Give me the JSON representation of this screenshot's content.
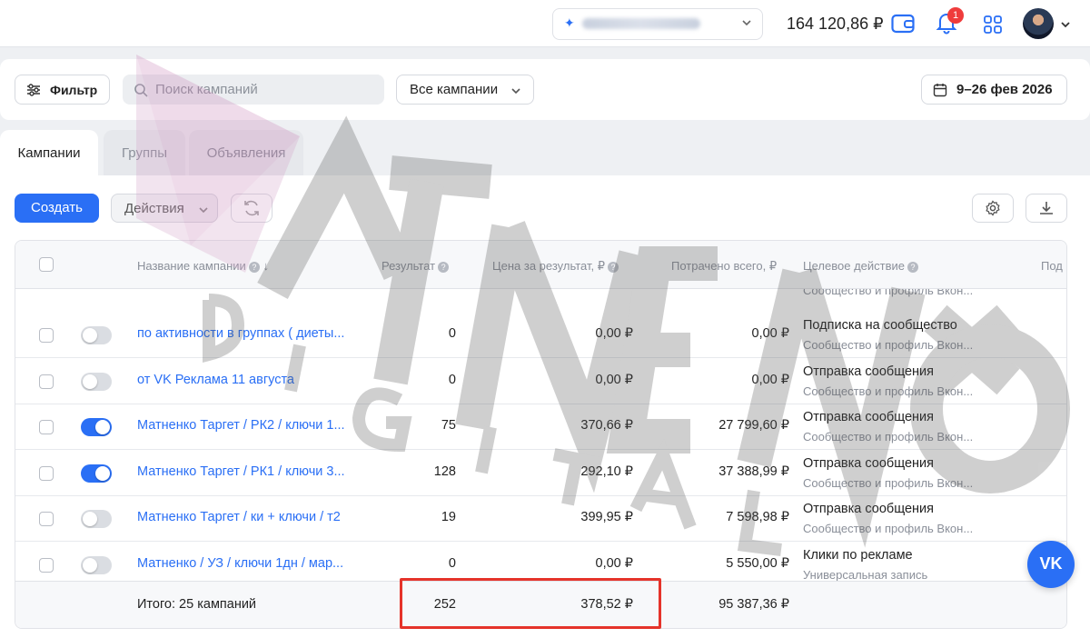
{
  "header": {
    "balance": "164 120,86 ₽",
    "notifications_count": "1"
  },
  "filterbar": {
    "filter_label": "Фильтр",
    "search_placeholder": "Поиск кампаний",
    "campaigns_select": "Все кампании",
    "date_range": "9–26 фев 2026"
  },
  "tabs": [
    {
      "label": "Кампании",
      "active": true
    },
    {
      "label": "Группы",
      "active": false
    },
    {
      "label": "Объявления",
      "active": false
    }
  ],
  "toolbar": {
    "create_label": "Создать",
    "actions_label": "Действия"
  },
  "table": {
    "columns": {
      "name": "Название кампании",
      "result": "Результат",
      "price": "Цена за результат, ₽",
      "spent": "Потрачено всего, ₽",
      "target": "Целевое действие",
      "extra": "Под"
    },
    "partial_top_sub": "Сообщество и профиль Вкон...",
    "rows": [
      {
        "name": "по активности в группах ( диеты...",
        "enabled": false,
        "result": "0",
        "price": "0,00 ₽",
        "spent": "0,00 ₽",
        "target": "Подписка на сообщество",
        "target_sub": "Сообщество и профиль Вкон..."
      },
      {
        "name": "от VK Реклама 11 августа",
        "enabled": false,
        "result": "0",
        "price": "0,00 ₽",
        "spent": "0,00 ₽",
        "target": "Отправка сообщения",
        "target_sub": "Сообщество и профиль Вкон..."
      },
      {
        "name": "Матненко Таргет / РК2 / ключи 1...",
        "enabled": true,
        "result": "75",
        "price": "370,66 ₽",
        "spent": "27 799,60 ₽",
        "target": "Отправка сообщения",
        "target_sub": "Сообщество и профиль Вкон..."
      },
      {
        "name": "Матненко Таргет / РК1 / ключи 3...",
        "enabled": true,
        "result": "128",
        "price": "292,10 ₽",
        "spent": "37 388,99 ₽",
        "target": "Отправка сообщения",
        "target_sub": "Сообщество и профиль Вкон..."
      },
      {
        "name": "Матненко Таргет / ки + ключи / т2",
        "enabled": false,
        "result": "19",
        "price": "399,95 ₽",
        "spent": "7 598,98 ₽",
        "target": "Отправка сообщения",
        "target_sub": "Сообщество и профиль Вкон..."
      },
      {
        "name": "Матненко / УЗ / ключи 1дн / мар...",
        "enabled": false,
        "result": "0",
        "price": "0,00 ₽",
        "spent": "5 550,00 ₽",
        "target": "Клики по рекламе",
        "target_sub": "Универсальная запись"
      }
    ],
    "totals": {
      "label": "Итого: 25 кампаний",
      "result": "252",
      "price": "378,52 ₽",
      "spent": "95 387,36 ₽"
    }
  },
  "vk_button": "VK",
  "colors": {
    "accent": "#2a6ff5",
    "highlight": "#e5332a",
    "badge": "#ef3c3c"
  }
}
